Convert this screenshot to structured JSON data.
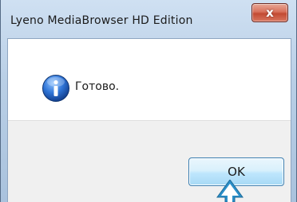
{
  "window": {
    "title": "Lyeno MediaBrowser HD Edition",
    "close_label": "x"
  },
  "message": {
    "icon": "info-icon",
    "text": "Готово."
  },
  "buttons": {
    "ok_label": "OK"
  },
  "colors": {
    "title_bar": "#b9cfe6",
    "close_button": "#c24a32",
    "ok_button_border": "#3c7fb1",
    "info_icon": "#1f5fbf",
    "pointer_arrow": "#2a8fc9"
  }
}
